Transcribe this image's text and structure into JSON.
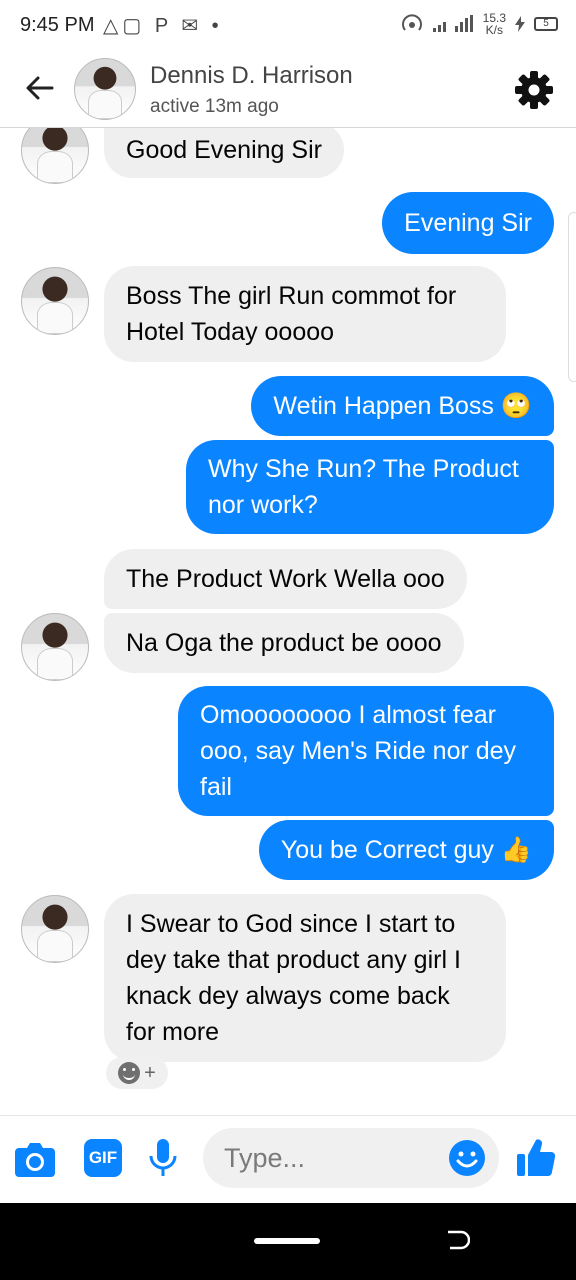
{
  "status_bar": {
    "time": "9:45 PM",
    "icons_left": "△▢ P ✉ •",
    "speed_value": "15.3",
    "speed_unit": "K/s",
    "battery": "5"
  },
  "header": {
    "contact_name": "Dennis D. Harrison",
    "contact_status": "active 13m ago",
    "back_icon": "arrow-left-icon",
    "settings_icon": "gear-icon"
  },
  "messages": [
    {
      "from": "them",
      "text": "Good Evening Sir"
    },
    {
      "from": "me",
      "text": "Evening Sir"
    },
    {
      "from": "them",
      "text": "Boss The girl Run commot for Hotel Today ooooo"
    },
    {
      "from": "me",
      "text": "Wetin Happen Boss 🙄"
    },
    {
      "from": "me",
      "text": "Why She Run? The Product nor work?"
    },
    {
      "from": "them",
      "text": "The Product Work Wella ooo"
    },
    {
      "from": "them",
      "text": "Na Oga the product be oooo"
    },
    {
      "from": "me",
      "text": "Omoooooooo I almost fear ooo, say Men's Ride nor dey fail"
    },
    {
      "from": "me",
      "text": "You be Correct guy 👍"
    },
    {
      "from": "them",
      "text": "I Swear to God since I start to dey take that product any girl I knack dey always come back for more"
    }
  ],
  "reaction": {
    "icon": "smiley-icon",
    "plus": "+"
  },
  "composer": {
    "placeholder": "Type...",
    "gif_label": "GIF",
    "icons": [
      "camera-icon",
      "gif-icon",
      "microphone-icon",
      "emoji-icon",
      "thumbs-up-icon"
    ]
  },
  "colors": {
    "accent": "#0a84ff",
    "incoming_bubble": "#efefef",
    "nav_bar": "#000000"
  }
}
